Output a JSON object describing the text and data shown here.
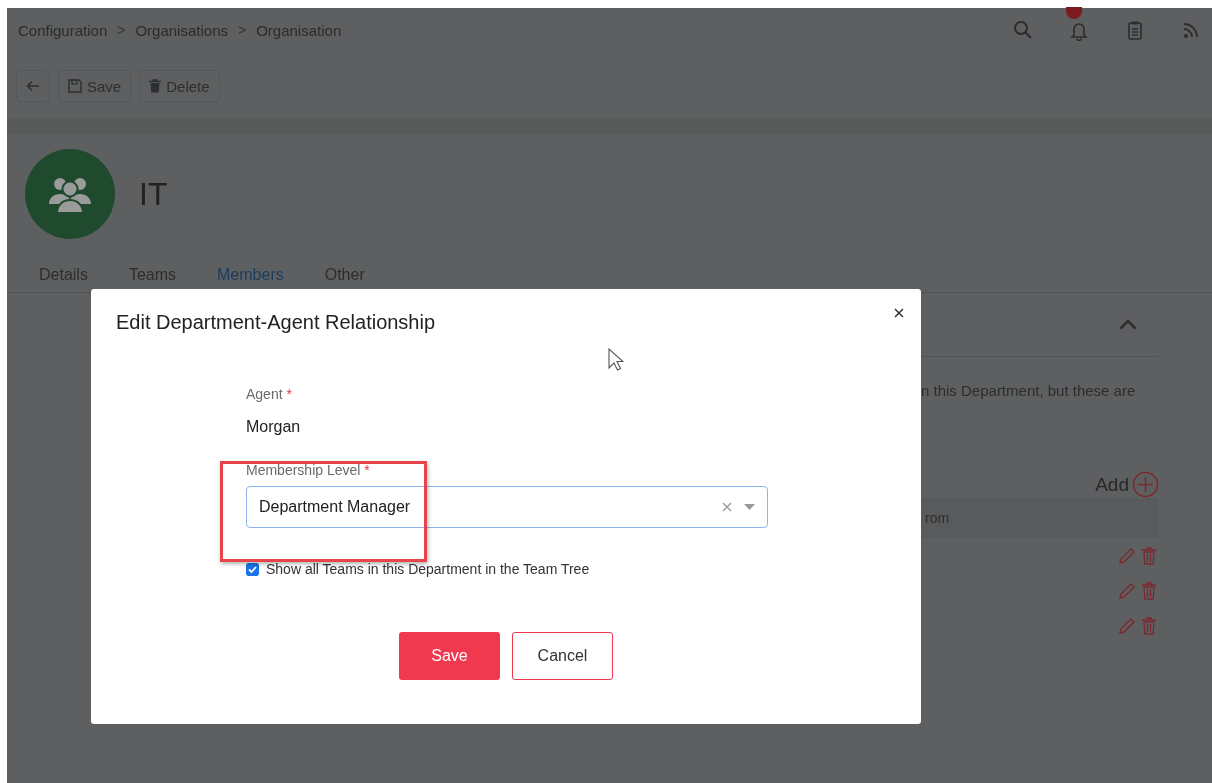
{
  "breadcrumb": [
    {
      "kind": "link",
      "label": "Configuration"
    },
    {
      "kind": "separator",
      "label": ">"
    },
    {
      "kind": "link",
      "label": "Organisations"
    },
    {
      "kind": "separator",
      "label": ">"
    },
    {
      "kind": "link",
      "label": "Organisation"
    }
  ],
  "header_icons": [
    {
      "kind": "search"
    },
    {
      "kind": "bell",
      "badge": true
    },
    {
      "kind": "clipboard"
    },
    {
      "kind": "rss"
    }
  ],
  "toolbar": [
    {
      "kind": "back"
    },
    {
      "kind": "save",
      "label": "Save"
    },
    {
      "kind": "delete",
      "label": "Delete"
    }
  ],
  "record": {
    "title": "IT"
  },
  "tabs": [
    {
      "label": "Details",
      "selected": false
    },
    {
      "label": "Teams",
      "selected": false
    },
    {
      "label": "Members",
      "selected": true
    },
    {
      "label": "Other",
      "selected": false
    }
  ],
  "members_panel": {
    "expanded": true,
    "description": "n this Department, but these are",
    "add_label": "Add",
    "column_header": "rom",
    "rows": [
      {
        "kind": "actions"
      },
      {
        "kind": "actions"
      },
      {
        "kind": "actions"
      }
    ]
  },
  "dialog": {
    "title": "Edit Department-Agent Relationship",
    "fields": [
      {
        "kind": "static",
        "label": "Agent",
        "required_mark": "*",
        "value": "Morgan"
      },
      {
        "kind": "select",
        "label": "Membership Level",
        "required_mark": "*",
        "value": "Department Manager",
        "highlighted": true
      }
    ],
    "checkbox": {
      "label": "Show all Teams in this Department in the Team Tree",
      "checked": true
    },
    "buttons": [
      {
        "kind": "primary",
        "label": "Save"
      },
      {
        "kind": "secondary",
        "label": "Cancel"
      }
    ]
  }
}
